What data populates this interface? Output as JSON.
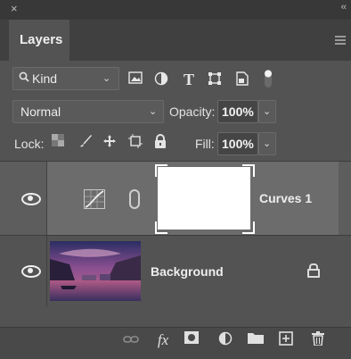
{
  "panel": {
    "close_glyph": "×",
    "collapse_glyph": "‹‹",
    "tab_label": "Layers",
    "menu_icon": "hamburger-icon"
  },
  "filter": {
    "kind_label": "Kind",
    "kind_icon": "search-icon",
    "icons": [
      "image-filter-icon",
      "adjustment-filter-icon",
      "type-filter-icon",
      "shape-filter-icon",
      "smart-object-filter-icon",
      "filter-toggle-icon"
    ]
  },
  "blend": {
    "mode": "Normal",
    "opacity_label": "Opacity:",
    "opacity_value": "100%"
  },
  "lock": {
    "label": "Lock:",
    "icons": [
      "lock-transparent-icon",
      "lock-image-icon",
      "lock-position-icon",
      "lock-artboard-icon",
      "lock-all-icon"
    ],
    "fill_label": "Fill:",
    "fill_value": "100%"
  },
  "layers": [
    {
      "name": "Curves 1",
      "type": "adjustment",
      "visible": true,
      "selected": true,
      "icon": "curves-adjustment-icon"
    },
    {
      "name": "Background",
      "type": "image",
      "visible": true,
      "selected": false,
      "locked": true
    }
  ],
  "footer": {
    "icons": [
      "link-layers-icon",
      "fx-icon",
      "add-mask-icon",
      "new-adjustment-icon",
      "new-group-icon",
      "new-layer-icon",
      "delete-icon"
    ],
    "fx_label": "fx"
  }
}
